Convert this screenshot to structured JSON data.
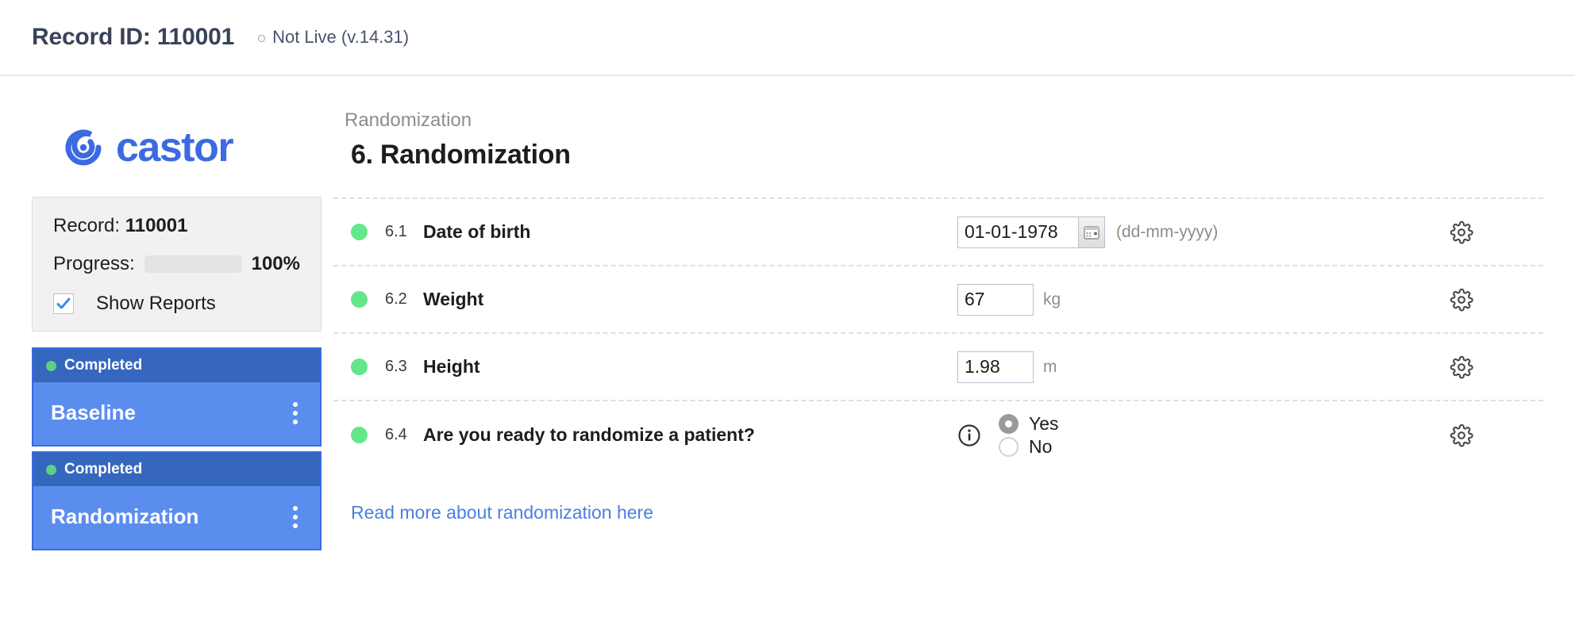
{
  "header": {
    "record_id_label": "Record ID: 110001",
    "live_status": "Not Live (v.14.31)",
    "status_dot_icon": "circle-outline-icon"
  },
  "sidebar": {
    "logo": {
      "text": "castor",
      "mark_icon": "castor-spiral-logo",
      "color": "#3c6ae1"
    },
    "record_panel": {
      "record_label_prefix": "Record: ",
      "record_value": "110001",
      "progress_label": "Progress:",
      "progress_percent_text": "100%",
      "progress_percent": 100,
      "progress_color": "#5cb85c",
      "show_reports_label": "Show Reports",
      "show_reports_checked": true,
      "check_icon": "checkmark-icon"
    },
    "nav_items": [
      {
        "status": "Completed",
        "title": "Baseline",
        "menu_icon": "kebab-menu-icon",
        "status_dot_icon": "status-dot-icon"
      },
      {
        "status": "Completed",
        "title": "Randomization",
        "menu_icon": "kebab-menu-icon",
        "status_dot_icon": "status-dot-icon"
      }
    ]
  },
  "main": {
    "breadcrumb": "Randomization",
    "title": "6. Randomization",
    "more_link": "Read more about randomization here",
    "gear_icon": "gear-icon",
    "info_icon": "info-icon",
    "fields": [
      {
        "number": "6.1",
        "label": "Date of birth",
        "type": "date",
        "value": "01-01-1978",
        "hint": "(dd-mm-yyyy)",
        "picker_icon": "calendar-icon",
        "status_dot_icon": "status-dot-icon"
      },
      {
        "number": "6.2",
        "label": "Weight",
        "type": "number",
        "value": "67",
        "unit": "kg",
        "status_dot_icon": "status-dot-icon"
      },
      {
        "number": "6.3",
        "label": "Height",
        "type": "number",
        "value": "1.98",
        "unit": "m",
        "status_dot_icon": "status-dot-icon"
      },
      {
        "number": "6.4",
        "label": "Are you ready to randomize a patient?",
        "type": "radio",
        "options": [
          {
            "label": "Yes",
            "selected": true
          },
          {
            "label": "No",
            "selected": false
          }
        ],
        "status_dot_icon": "status-dot-icon"
      }
    ]
  }
}
